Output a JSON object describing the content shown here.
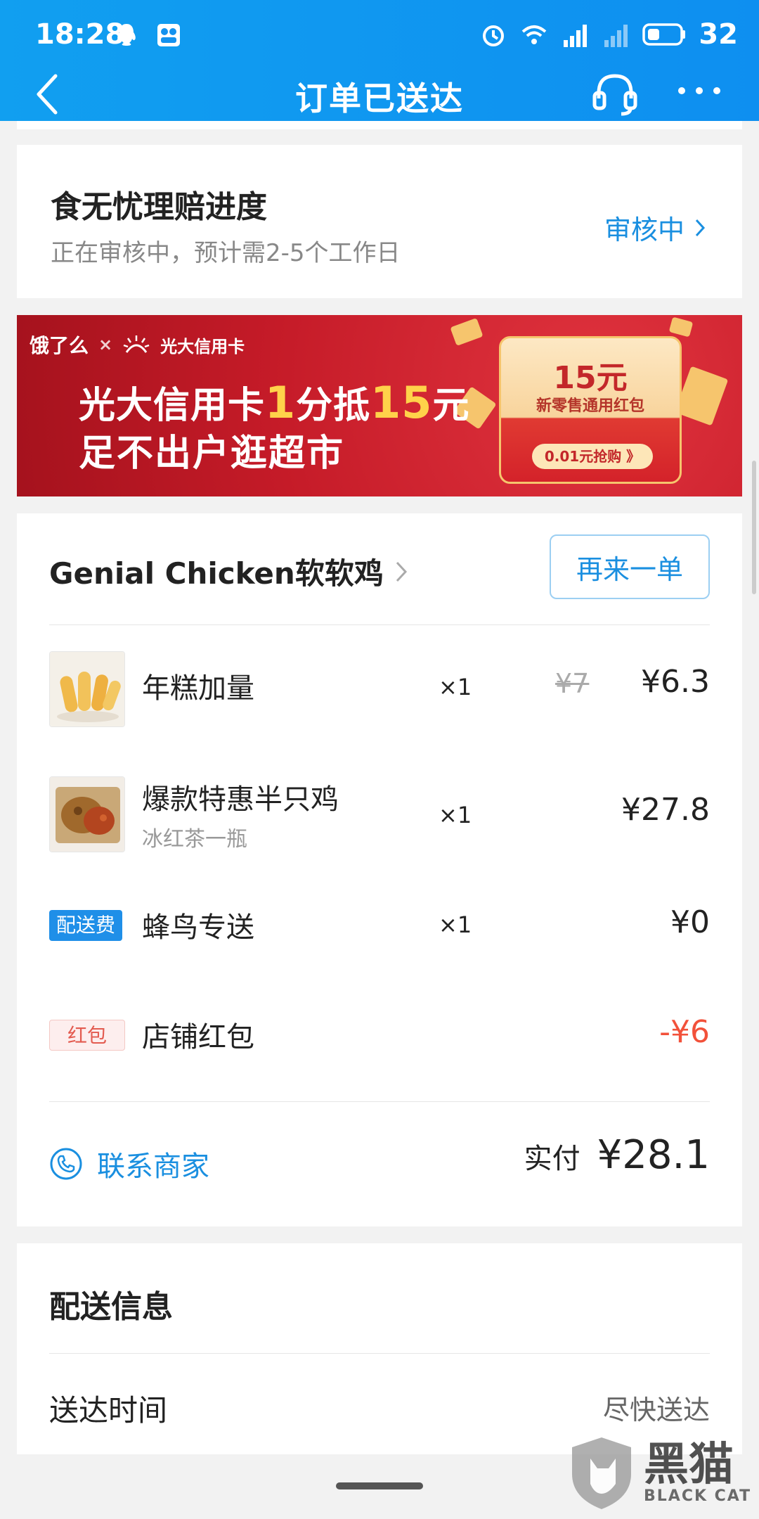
{
  "status_bar": {
    "time": "18:28",
    "battery": "32"
  },
  "nav": {
    "title": "订单已送达"
  },
  "claim": {
    "title": "食无忧理赔进度",
    "subtitle": "正在审核中，预计需2-5个工作日",
    "status": "审核中"
  },
  "banner": {
    "brand_left": "饿了么",
    "brand_x": "×",
    "brand_right": "光大信用卡",
    "line1_prefix": "光大信用卡",
    "line1_a": "1",
    "line1_mid": "分抵",
    "line1_b": "15",
    "line1_suffix": "元",
    "line2": "足不出户逛超市",
    "coupon_amount": "15元",
    "coupon_desc": "新零售通用红包",
    "coupon_button": "0.01元抢购 》"
  },
  "order": {
    "shop_name": "Genial Chicken软软鸡",
    "reorder_label": "再来一单",
    "items": [
      {
        "name": "年糕加量",
        "sub": "",
        "qty": "×1",
        "original_price": "¥7",
        "price": "¥6.3"
      },
      {
        "name": "爆款特惠半只鸡",
        "sub": "冰红茶一瓶",
        "qty": "×1",
        "original_price": "",
        "price": "¥27.8"
      },
      {
        "tag": "配送费",
        "name": "蜂鸟专送",
        "qty": "×1",
        "price": "¥0"
      },
      {
        "tag": "红包",
        "name": "店铺红包",
        "price": "-¥6"
      }
    ],
    "contact_label": "联系商家",
    "paid_label": "实付",
    "paid_amount": "¥28.1"
  },
  "delivery": {
    "title": "配送信息",
    "time_label": "送达时间",
    "time_value": "尽快送达"
  },
  "watermark": {
    "big": "黑猫",
    "small": "BLACK CAT"
  },
  "colors": {
    "header": "#119ff0",
    "accent": "#1a8fe0",
    "discount": "#f2513a",
    "banner": "#c51b28"
  }
}
